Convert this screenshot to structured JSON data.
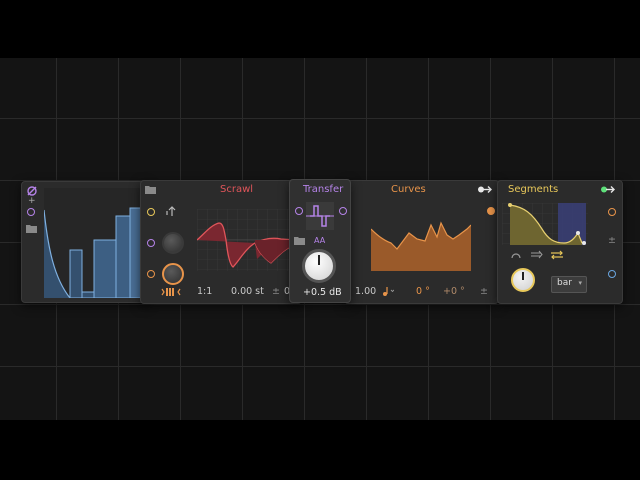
{
  "modules": {
    "scrawl": {
      "title": "Scrawl",
      "ratio": "1:1",
      "pitch": "0.00 st",
      "pm": "±",
      "extra": "0"
    },
    "transfer": {
      "title": "Transfer",
      "aa": "AA",
      "gain": "+0.5 dB"
    },
    "curves": {
      "title": "Curves",
      "amount": "1.00",
      "phase": "0 °",
      "offset": "+0 °",
      "pm": "±"
    },
    "segments": {
      "title": "Segments",
      "mode": "bar",
      "pm": "±"
    }
  },
  "colors": {
    "scrawl": "#e0555a",
    "transfer": "#b583e8",
    "curves": "#e8944a",
    "segments": "#e8c85a",
    "steps": "#5a86b8",
    "port_orange": "#e8944a",
    "port_purple": "#b583e8",
    "port_blue": "#6aa6e0"
  }
}
